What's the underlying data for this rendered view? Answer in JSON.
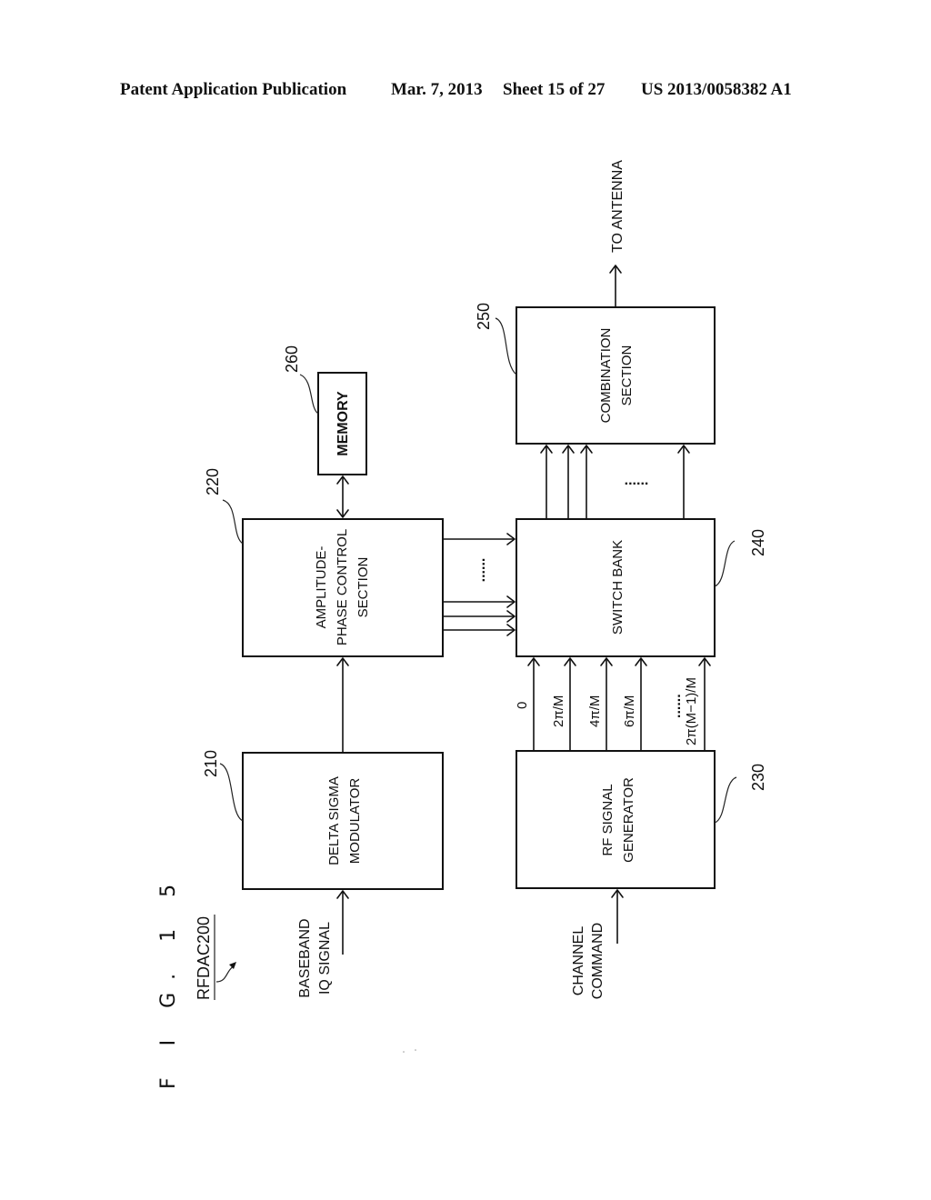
{
  "header": {
    "publication": "Patent Application Publication",
    "date": "Mar. 7, 2013",
    "sheet": "Sheet 15 of 27",
    "patent_number": "US 2013/0058382 A1"
  },
  "figure": {
    "title": "F I G. 1 5",
    "device_label": "RFDAC200"
  },
  "blocks": {
    "delta_sigma": {
      "ref": "210",
      "line1": "DELTA SIGMA",
      "line2": "MODULATOR"
    },
    "amplitude_phase": {
      "ref": "220",
      "line1": "AMPLITUDE-",
      "line2": "PHASE CONTROL",
      "line3": "SECTION"
    },
    "rf_generator": {
      "ref": "230",
      "line1": "RF SIGNAL",
      "line2": "GENERATOR"
    },
    "switch_bank": {
      "ref": "240",
      "line1": "SWITCH BANK"
    },
    "combination": {
      "ref": "250",
      "line1": "COMBINATION",
      "line2": "SECTION"
    },
    "memory": {
      "ref": "260",
      "line1": "MEMORY"
    }
  },
  "inputs": {
    "baseband": {
      "line1": "BASEBAND",
      "line2": "IQ SIGNAL"
    },
    "channel": {
      "line1": "CHANNEL",
      "line2": "COMMAND"
    }
  },
  "output": {
    "label": "TO ANTENNA"
  },
  "phases": [
    "0",
    "2π/M",
    "4π/M",
    "6π/M",
    "2π(M−1)/M"
  ],
  "ellipsis": "......"
}
